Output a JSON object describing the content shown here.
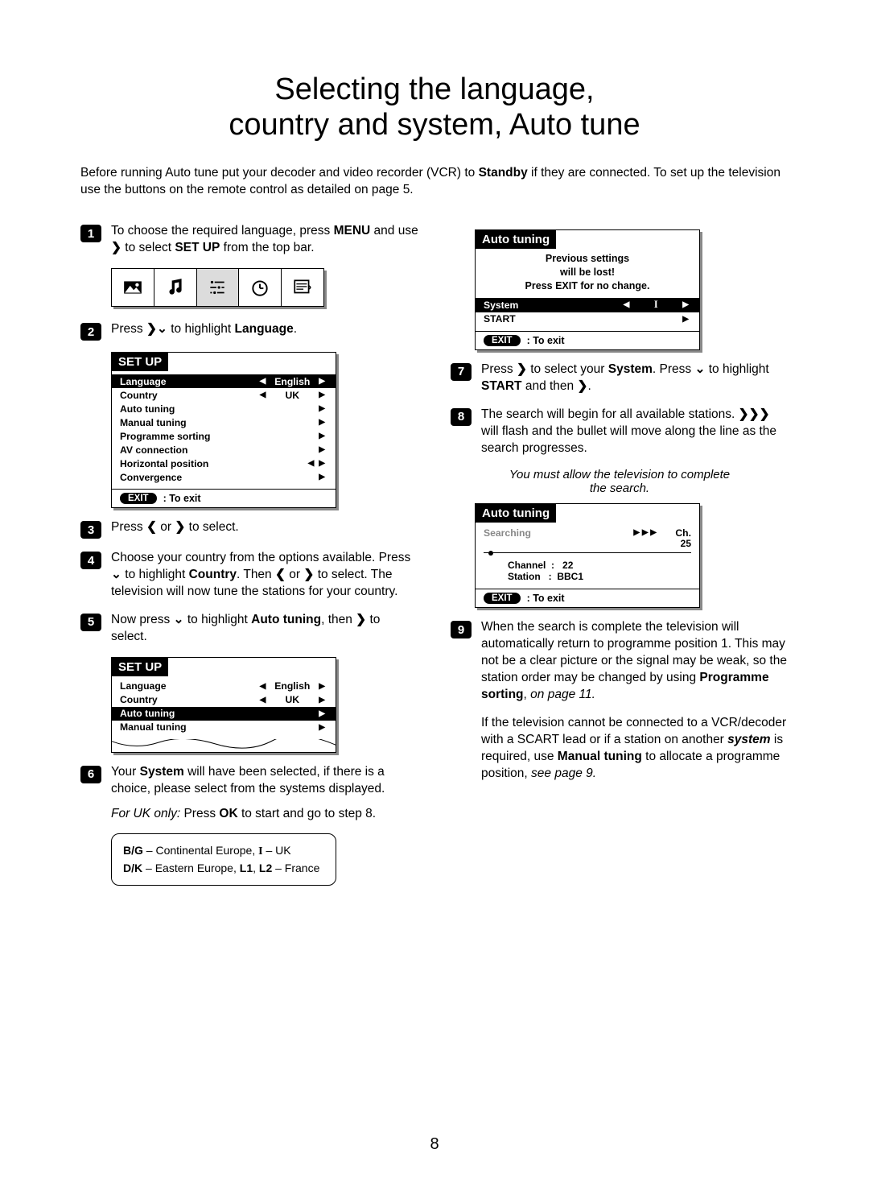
{
  "title_line1": "Selecting the language,",
  "title_line2": "country and system, Auto tune",
  "intro_a": "Before running Auto tune put your decoder and video recorder (VCR) to ",
  "intro_bold": "Standby",
  "intro_b": " if they are connected. To set up the television use the buttons on the remote control as detailed on page 5.",
  "steps": {
    "s1a": "To choose the required language, press ",
    "s1b": "MENU",
    "s1c": " and use ",
    "s1d": " to select ",
    "s1e": "SET UP",
    "s1f": " from the top bar.",
    "s2a": "Press ",
    "s2b": " to highlight ",
    "s2c": "Language",
    "s2d": ".",
    "s3": "Press ",
    "s3b": " or ",
    "s3c": " to select.",
    "s4a": "Choose your country from the options available. Press ",
    "s4b": " to highlight ",
    "s4c": "Country",
    "s4d": ". Then ",
    "s4e": " or ",
    "s4f": " to select. The television will now tune the stations for your country.",
    "s5a": "Now press ",
    "s5b": " to highlight ",
    "s5c": "Auto tuning",
    "s5d": ", then ",
    "s5e": " to select.",
    "s6a": "Your ",
    "s6b": "System",
    "s6c": " will have been selected, if there is a choice, please select from the systems displayed.",
    "s6note": "For UK only: ",
    "s6note_b": "Press ",
    "s6note_c": "OK",
    "s6note_d": " to start and go to step 8.",
    "s7a": "Press ",
    "s7b": " to select your ",
    "s7c": "System",
    "s7d": ". Press ",
    "s7e": " to highlight ",
    "s7f": "START",
    "s7g": " and then ",
    "s7h": ".",
    "s8a": "The search will begin for all available stations. ",
    "s8b": " will flash and the bullet will move along the line as the search progresses.",
    "s8note1": "You must allow the television to complete",
    "s8note2": "the search.",
    "s9a": "When the search is complete the television will automatically return to programme position 1. This may not be a clear picture or the signal may be weak, so the station order may be changed by using ",
    "s9b": "Programme sorting",
    "s9c": ", ",
    "s9d": "on page 11.",
    "s9p2a": "If the television cannot be connected to a VCR/decoder with a SCART lead or if a station on another ",
    "s9p2b": "system",
    "s9p2c": " is required, use ",
    "s9p2d": "Manual tuning",
    "s9p2e": " to allocate a programme position, ",
    "s9p2f": "see page 9."
  },
  "osd": {
    "setup_title": "SET UP",
    "auto_title": "Auto tuning",
    "rows": {
      "language": "Language",
      "country": "Country",
      "auto": "Auto tuning",
      "manual": "Manual tuning",
      "prog": "Programme sorting",
      "av": "AV connection",
      "horiz": "Horizontal position",
      "conv": "Convergence"
    },
    "val_english": "English",
    "val_uk": "UK",
    "exit": "EXIT",
    "toexit": ": To exit",
    "prev1": "Previous settings",
    "prev2": "will be lost!",
    "prev3": "Press EXIT for no change.",
    "system": "System",
    "system_val": "I",
    "start": "START",
    "searching": "Searching",
    "ch_label": "Ch.",
    "ch_val": "25",
    "channel_label": "Channel",
    "channel_val": "22",
    "station_label": "Station",
    "station_val": "BBC1"
  },
  "sysbox": {
    "l1a": "B/G",
    "l1b": " – Continental Europe, ",
    "l1c": "I",
    "l1d": " – UK",
    "l2a": "D/K",
    "l2b": " – Eastern Europe, ",
    "l2c": "L1",
    "l2d": ", ",
    "l2e": "L2",
    "l2f": " – France"
  },
  "page": "8"
}
